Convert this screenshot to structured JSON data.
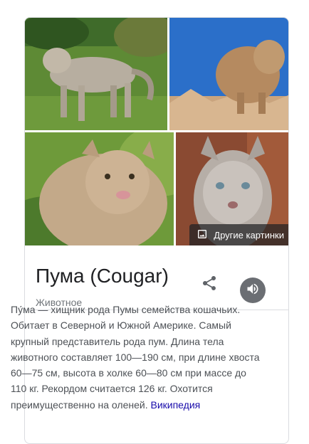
{
  "gallery": {
    "more_images_label": "Другие картинки",
    "more_images_icon": "image-icon"
  },
  "entity": {
    "title": "Пума (Cougar)",
    "subtitle": "Животное",
    "share_icon": "share-icon",
    "audio_icon": "speaker-icon"
  },
  "description": {
    "text": "Пу́ма — хищник рода Пумы семейства кошачьих. Обитает в Северной и Южной Америке. Самый крупный представитель рода пум. Длина тела животного составляет 100—190 см, при длине хвоста 60—75 см, высота в холке 60—80 см при массе до 110 кг. Рекордом считается 126 кг. Охотится преимущественно на оленей.",
    "source_link": "Википедия"
  },
  "colors": {
    "title": "#202124",
    "subtitle": "#70757a",
    "link": "#1a0dab",
    "audio_button": "#6b6e73"
  }
}
